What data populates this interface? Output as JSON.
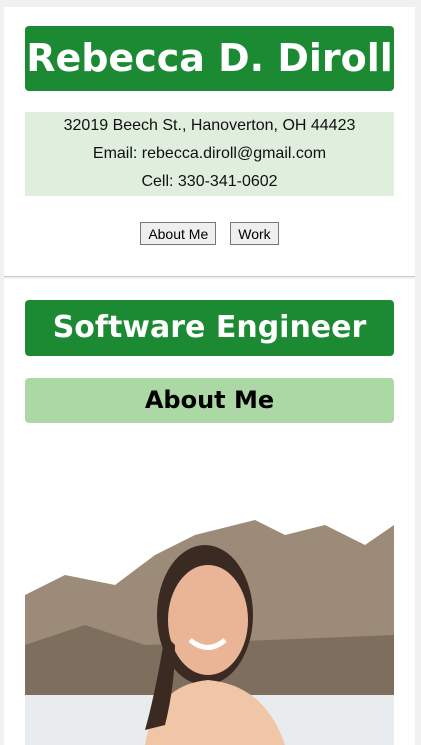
{
  "header": {
    "name": "Rebecca D. Diroll",
    "address": "32019 Beech St., Hanoverton, OH 44423",
    "email": "Email: rebecca.diroll@gmail.com",
    "cell": "Cell: 330-341-0602",
    "buttons": {
      "about": "About Me",
      "work": "Work"
    }
  },
  "main": {
    "title": "Software Engineer",
    "section": "About Me"
  },
  "colors": {
    "banner": "#1b8a32",
    "contact_bg": "#dfeedd",
    "section_bg": "#acd8a6"
  }
}
